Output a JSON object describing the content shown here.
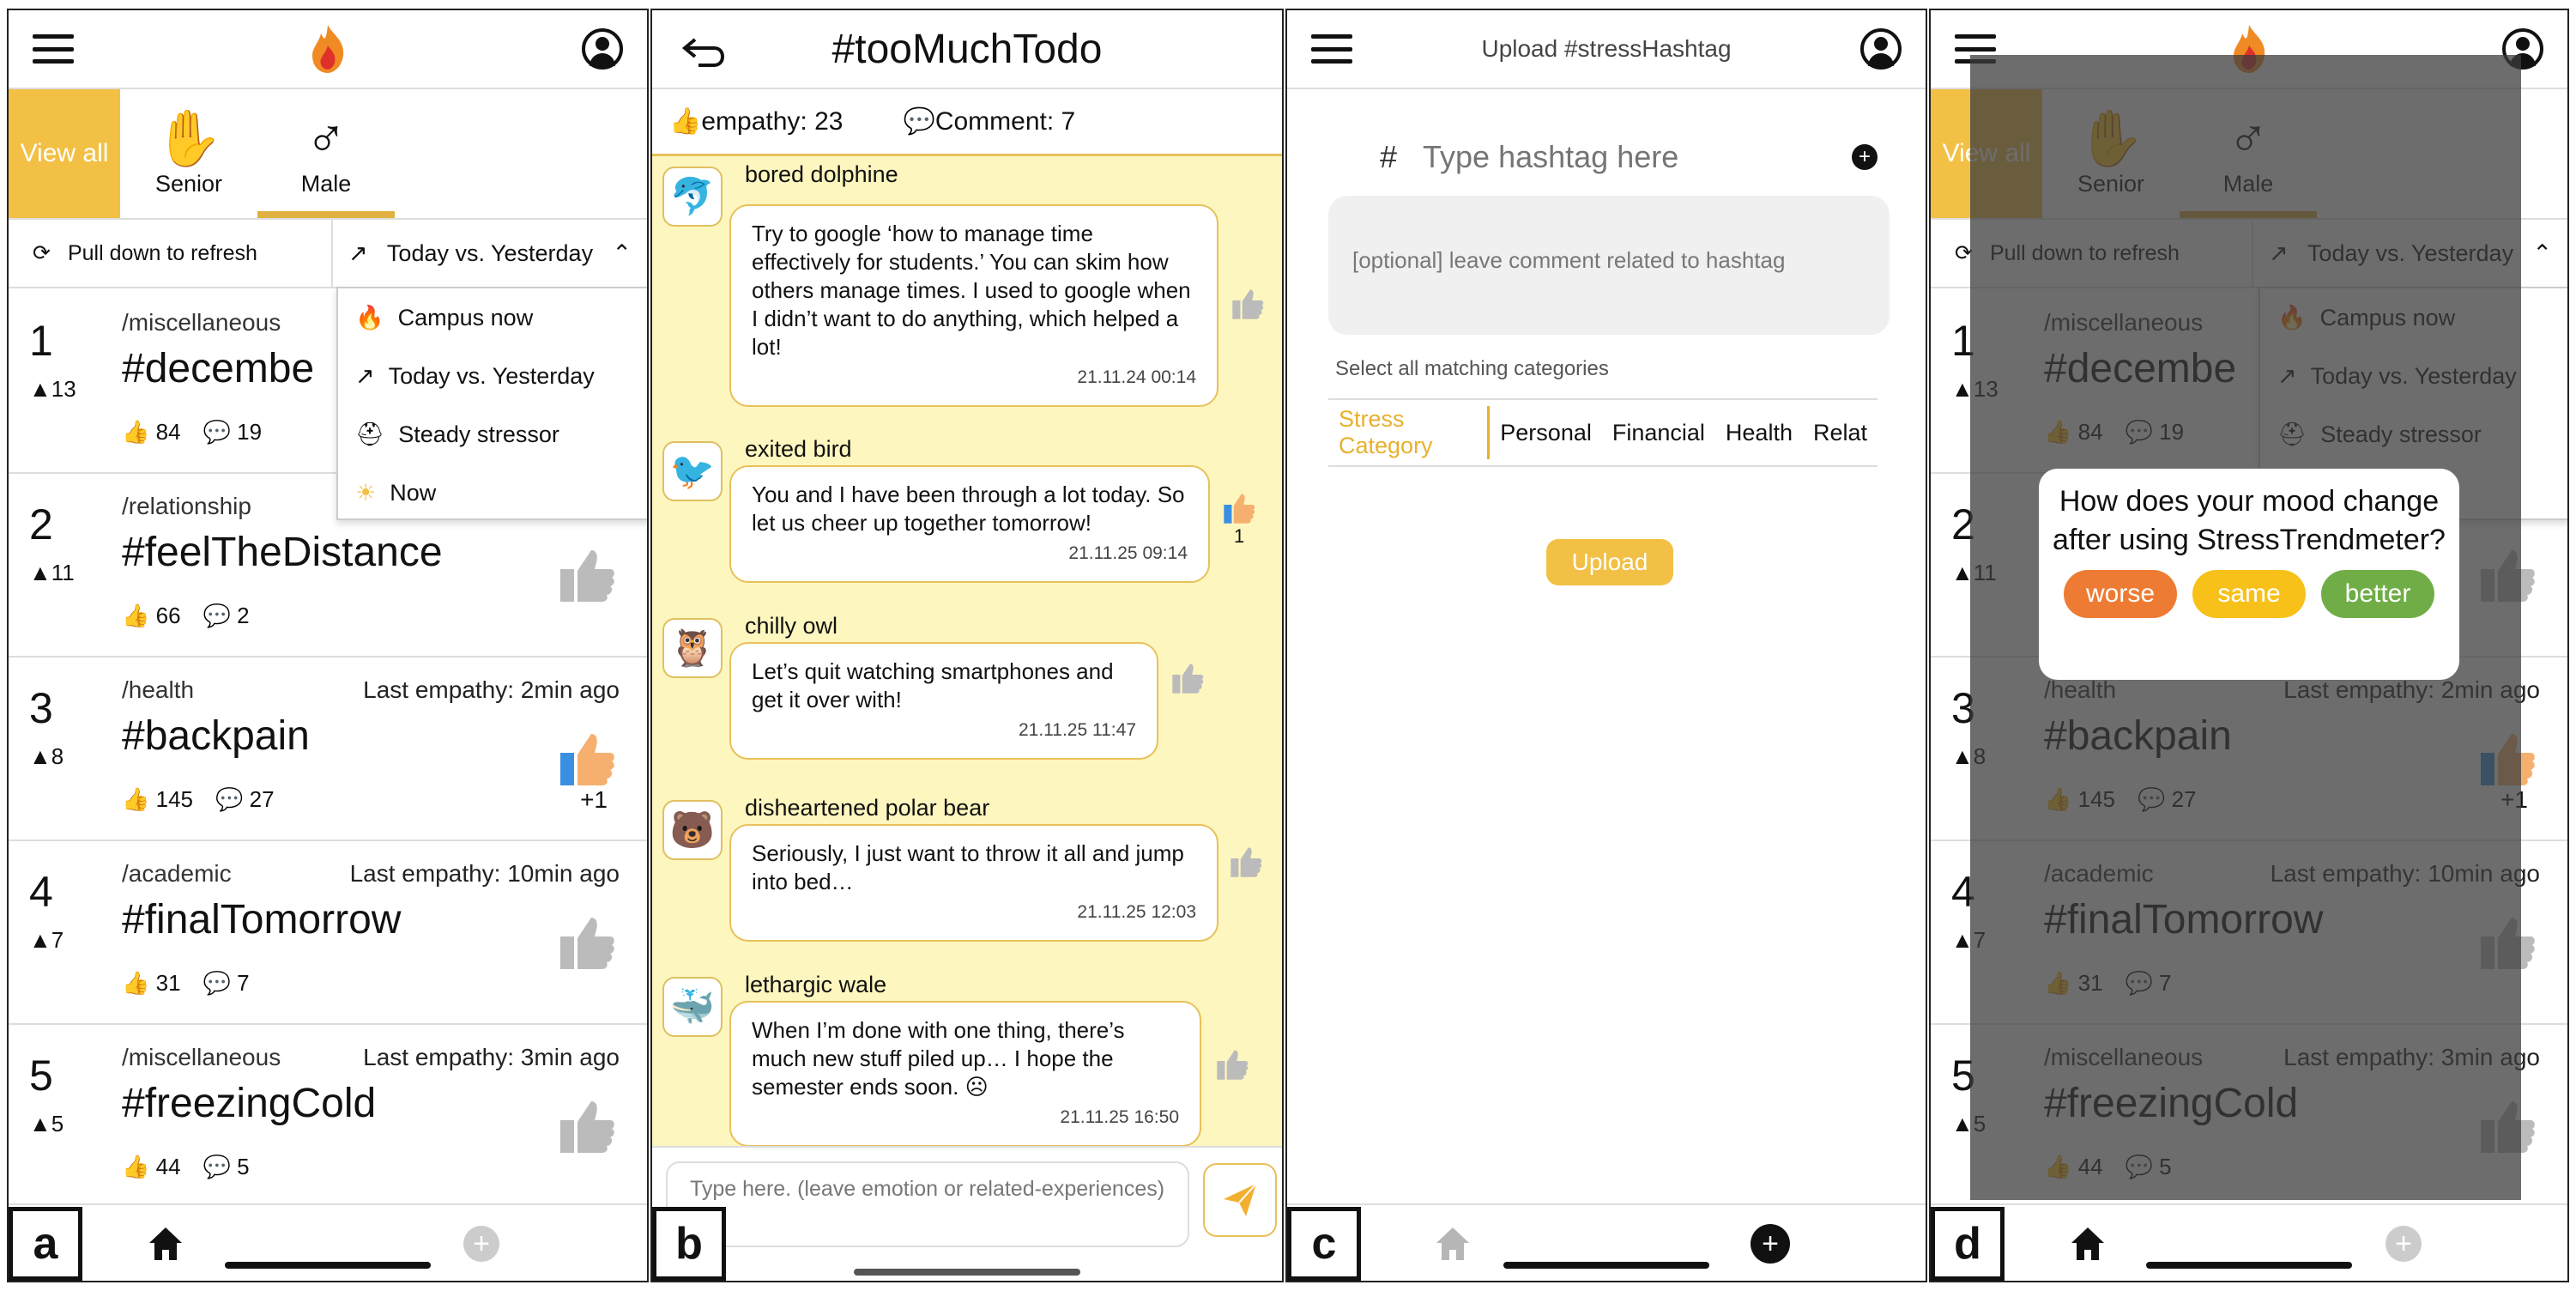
{
  "panels": {
    "a": {
      "label": "a",
      "filters": {
        "view_all": "View all",
        "tabs": [
          "Senior",
          "Male"
        ]
      },
      "refresh": "Pull down to refresh",
      "sort": {
        "selected": "Today vs. Yesterday",
        "options": [
          "Campus now",
          "Today vs. Yesterday",
          "Steady stressor",
          "Now"
        ]
      },
      "rows": [
        {
          "rank": "1",
          "up": "▲13",
          "category": "/miscellaneous",
          "tag": "#decembe",
          "empathy": "84",
          "comments": "19",
          "last": ""
        },
        {
          "rank": "2",
          "up": "▲11",
          "category": "/relationship",
          "tag": "#feelTheDistance",
          "empathy": "66",
          "comments": "2",
          "last": ""
        },
        {
          "rank": "3",
          "up": "▲8",
          "category": "/health",
          "tag": "#backpain",
          "empathy": "145",
          "comments": "27",
          "last": "Last empathy: 2min ago",
          "plus": "+1"
        },
        {
          "rank": "4",
          "up": "▲7",
          "category": "/academic",
          "tag": "#finalTomorrow",
          "empathy": "31",
          "comments": "7",
          "last": "Last empathy: 10min ago"
        },
        {
          "rank": "5",
          "up": "▲5",
          "category": "/miscellaneous",
          "tag": "#freezingCold",
          "empathy": "44",
          "comments": "5",
          "last": "Last empathy: 3min ago"
        }
      ]
    },
    "b": {
      "label": "b",
      "title": "#tooMuchTodo",
      "empathy": "empathy: 23",
      "comment": "Comment: 7",
      "messages": [
        {
          "user": "bored dolphine",
          "text": "Try to google ‘how to manage time effectively for students.’ You can skim how others manage times. I used to google when I didn’t want to do anything, which helped a lot!",
          "time": "21.11.24  00:14"
        },
        {
          "user": "exited bird",
          "text": "You and I have been through a lot today. So let us cheer up together tomorrow!",
          "time": "21.11.25  09:14",
          "likes": "1"
        },
        {
          "user": "chilly owl",
          "text": "Let’s quit watching smartphones and get it over with!",
          "time": "21.11.25  11:47"
        },
        {
          "user": "disheartened polar bear",
          "text": "Seriously, I just want to throw it all and jump into bed…",
          "time": "21.11.25  12:03"
        },
        {
          "user": "lethargic wale",
          "text": "When I’m done with one thing, there’s much new stuff piled up… I hope the semester ends soon. ☹",
          "time": "21.11.25  16:50"
        }
      ],
      "input_placeholder": "Type here. (leave emotion or related-experiences)"
    },
    "c": {
      "label": "c",
      "title": "Upload #stressHashtag",
      "hashtag_placeholder": "Type hashtag here",
      "comment_placeholder": "[optional] leave comment related to hashtag",
      "select_label": "Select all matching categories",
      "categories": [
        "Stress Category",
        "Personal",
        "Financial",
        "Health",
        "Relat"
      ],
      "upload": "Upload"
    },
    "d": {
      "label": "d",
      "popup": {
        "question": "How does your mood change after using StressTrendmeter?",
        "worse": "worse",
        "same": "same",
        "better": "better"
      }
    }
  },
  "colors": {
    "accent": "#F2C044",
    "worse": "#EE7B33",
    "same": "#F7C11A",
    "better": "#70AD47"
  }
}
